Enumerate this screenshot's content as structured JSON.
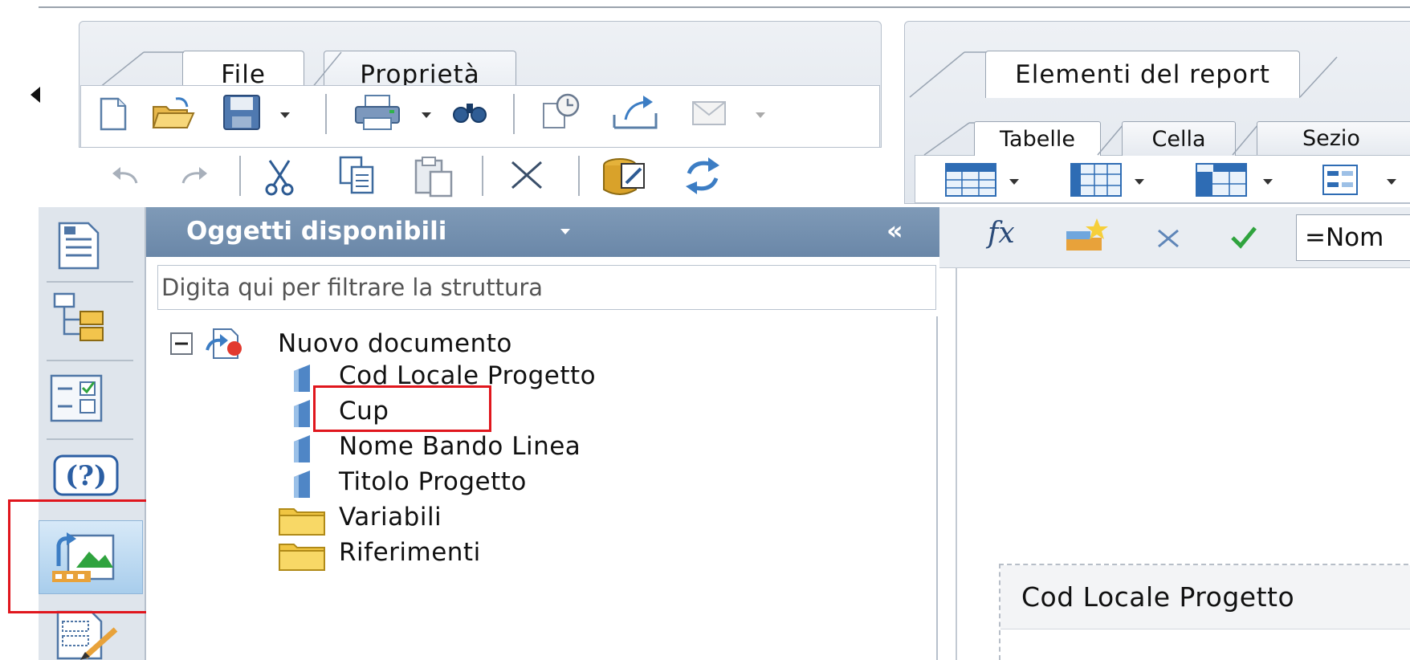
{
  "ribbon_left": {
    "tabs": [
      {
        "label": "File",
        "active": true
      },
      {
        "label": "Proprietà",
        "active": false
      }
    ],
    "toolbar_icons": [
      "new-document-icon",
      "open-folder-icon",
      "save-icon",
      "print-icon",
      "find-icon",
      "schedule-icon",
      "export-icon",
      "email-icon"
    ],
    "edit_icons": [
      "undo-icon",
      "redo-icon",
      "cut-icon",
      "copy-icon",
      "paste-icon",
      "delete-icon",
      "data-edit-icon",
      "refresh-icon"
    ]
  },
  "ribbon_right": {
    "tabs": [
      {
        "label": "Elementi del report",
        "active": true
      }
    ],
    "subtabs": [
      {
        "label": "Tabelle",
        "active": true
      },
      {
        "label": "Cella",
        "active": false
      },
      {
        "label": "Sezio",
        "active": false
      }
    ],
    "table_icons": [
      "horizontal-table-icon",
      "vertical-table-icon",
      "crosstab-icon",
      "form-icon"
    ]
  },
  "left_strip": {
    "icons": [
      "document-summary-icon",
      "document-structure-icon",
      "input-controls-icon",
      "help-icon",
      "available-objects-icon",
      "report-map-icon"
    ],
    "active": "available-objects-icon"
  },
  "objects_panel": {
    "title": "Oggetti disponibili",
    "collapse_glyph": "«",
    "filter_placeholder": "Digita qui per filtrare la struttura",
    "tree": {
      "root": "Nuovo documento",
      "dimensions": [
        "Cod Locale Progetto",
        "Cup",
        "Nome Bando Linea",
        "Titolo Progetto"
      ],
      "folders": [
        "Variabili",
        "Riferimenti"
      ]
    }
  },
  "formula_bar": {
    "fx_label": "fx",
    "input_value": "=Nom"
  },
  "report": {
    "header_cell": "Cod Locale Progetto"
  },
  "colors": {
    "panel_header": "#7390b0",
    "highlight": "#e0161d",
    "tab_border": "#9aa5b3"
  }
}
